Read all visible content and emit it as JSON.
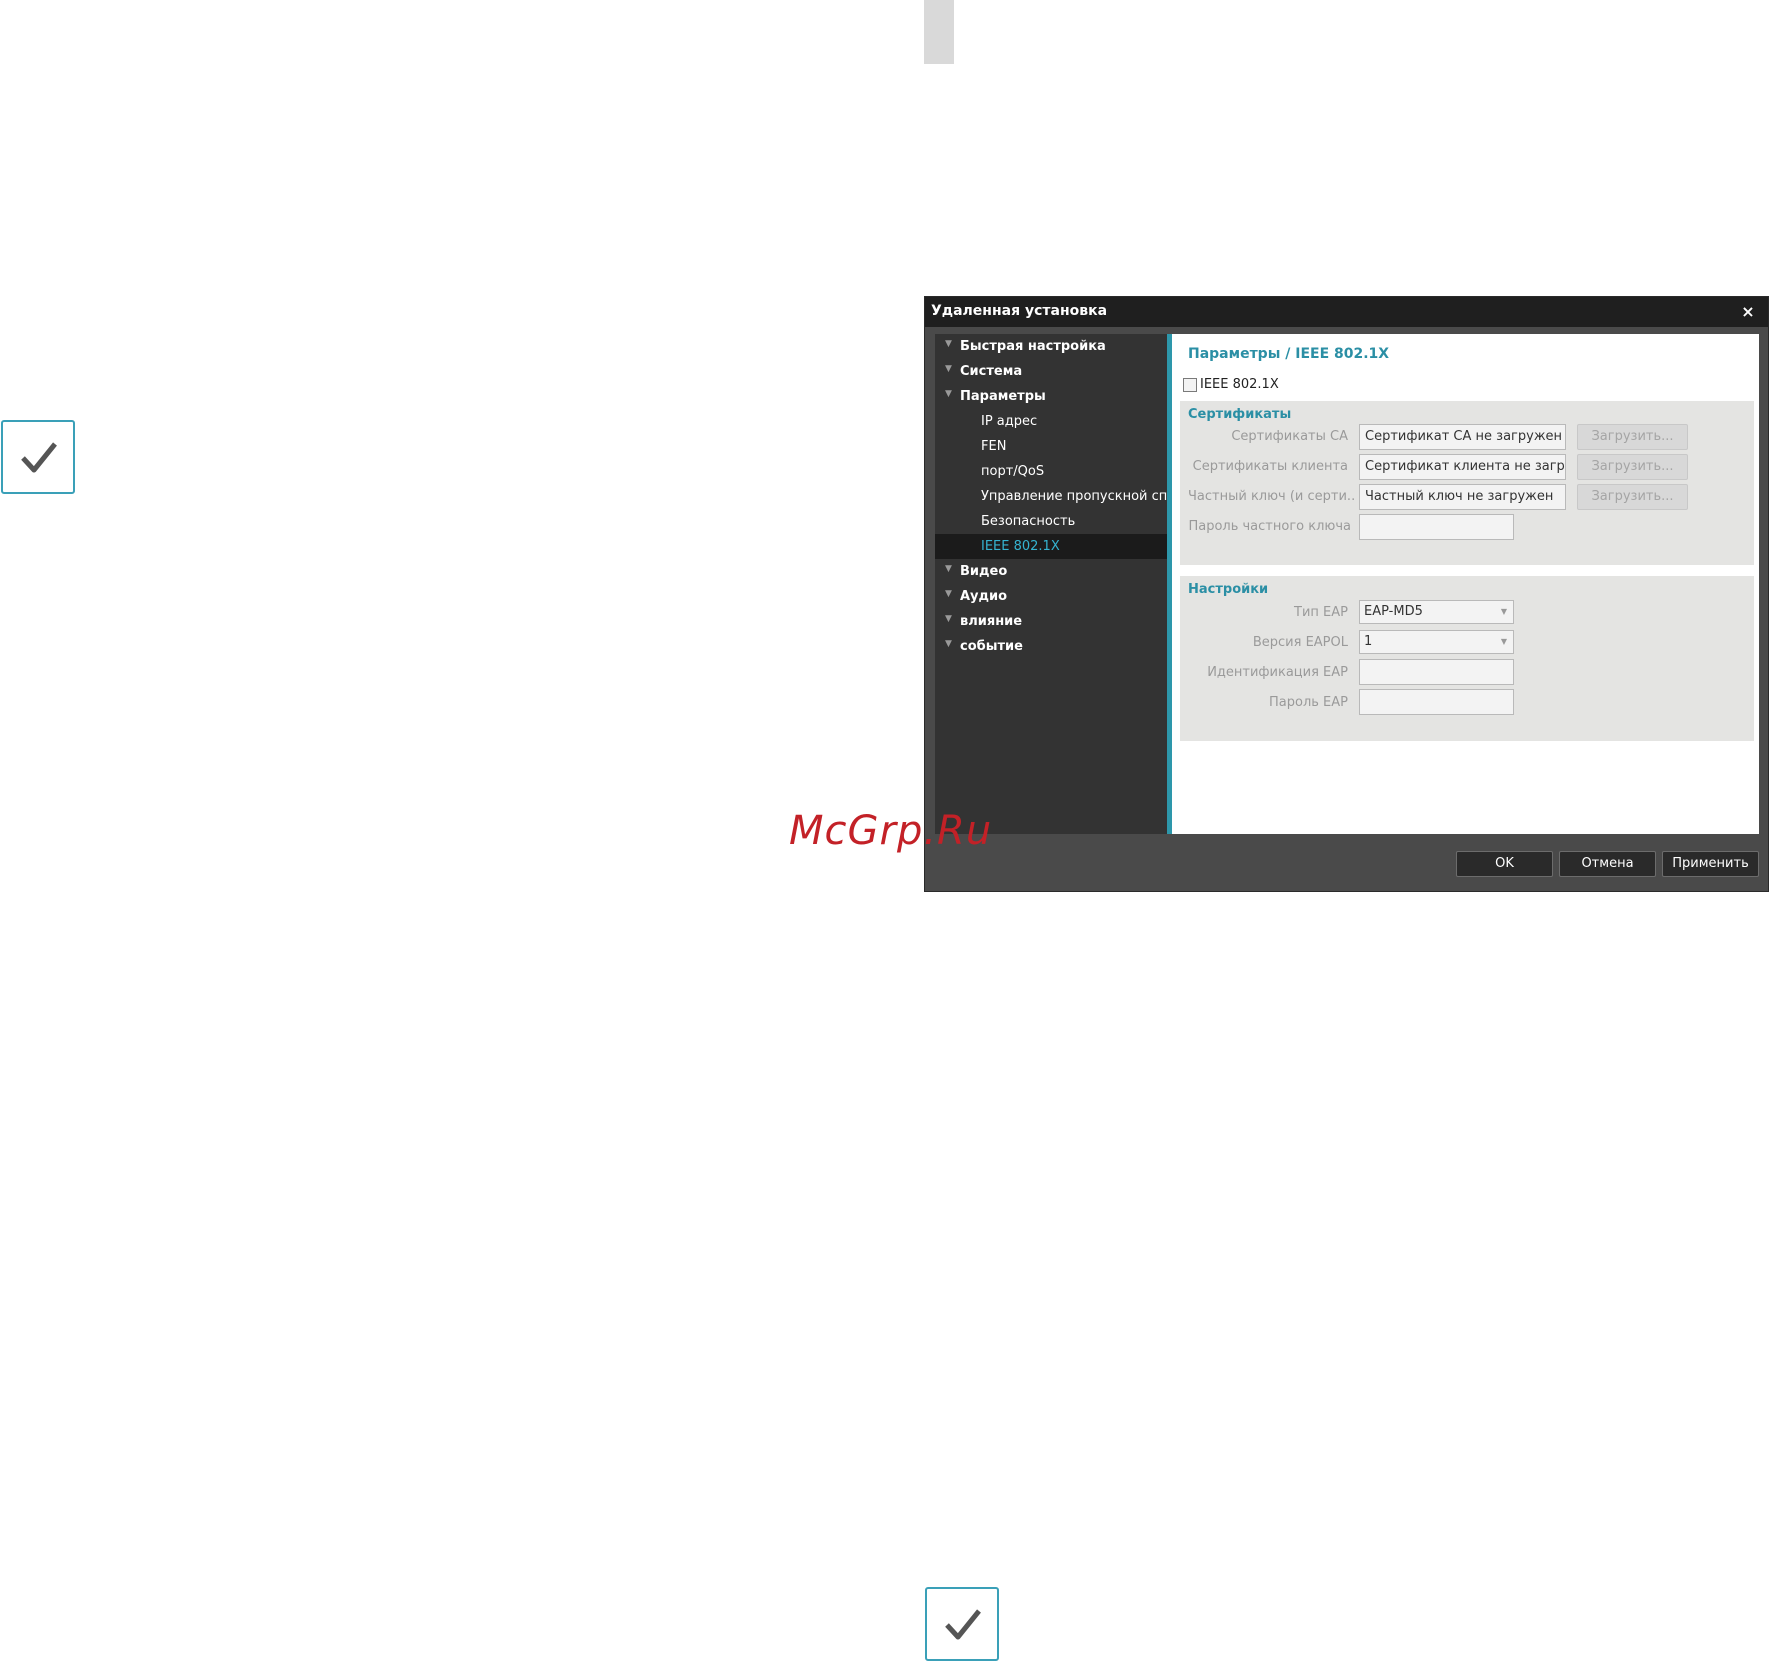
{
  "watermark": "McGrp.Ru",
  "dialog": {
    "title": "Удаленная установка",
    "close_label": "×",
    "tree": [
      {
        "label": "Быстрая настройка",
        "type": "group"
      },
      {
        "label": "Система",
        "type": "group"
      },
      {
        "label": "Параметры",
        "type": "group"
      },
      {
        "label": "IP адрес",
        "type": "child"
      },
      {
        "label": "FEN",
        "type": "child"
      },
      {
        "label": "порт/QoS",
        "type": "child"
      },
      {
        "label": "Управление пропускной способностью",
        "type": "child"
      },
      {
        "label": "Безопасность",
        "type": "child"
      },
      {
        "label": "IEEE 802.1X",
        "type": "child",
        "selected": true
      },
      {
        "label": "Видео",
        "type": "group"
      },
      {
        "label": "Аудио",
        "type": "group"
      },
      {
        "label": "влияние",
        "type": "group"
      },
      {
        "label": "событие",
        "type": "group"
      }
    ],
    "panel": {
      "breadcrumb": "Параметры / IEEE 802.1X",
      "enable_checkbox": {
        "label": "IEEE 802.1X",
        "checked": false
      },
      "certificates": {
        "title": "Сертификаты",
        "ca_label": "Сертификаты CA",
        "ca_value": "Сертификат CA не загружен",
        "client_label": "Сертификаты клиента",
        "client_value": "Сертификат клиента не загружен",
        "key_label": "Частный ключ (и серти...",
        "key_value": "Частный ключ не загружен",
        "key_password_label": "Пароль частного ключа",
        "key_password_value": "",
        "upload_label": "Загрузить..."
      },
      "settings": {
        "title": "Настройки",
        "eap_type_label": "Тип EAP",
        "eap_type_value": "EAP-MD5",
        "eapol_version_label": "Версия EAPOL",
        "eapol_version_value": "1",
        "eap_identity_label": "Идентификация EAP",
        "eap_identity_value": "",
        "eap_password_label": "Пароль EAP",
        "eap_password_value": ""
      }
    },
    "footer": {
      "ok_label": "OK",
      "cancel_label": "Отмена",
      "apply_label": "Применить"
    }
  },
  "colors": {
    "accent": "#2d97ab",
    "watermark": "#c32127",
    "note_border": "#3aa0b8"
  }
}
